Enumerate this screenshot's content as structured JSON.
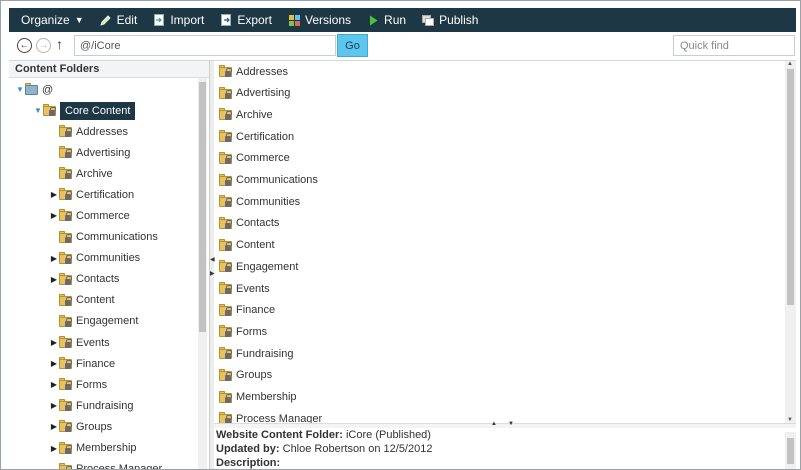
{
  "toolbar": {
    "organize": "Organize",
    "edit": "Edit",
    "import": "Import",
    "export": "Export",
    "versions": "Versions",
    "run": "Run",
    "publish": "Publish"
  },
  "address_bar": {
    "path_value": "@/iCore",
    "go_label": "Go",
    "quick_find_placeholder": "Quick find"
  },
  "content_folders": {
    "header": "Content Folders",
    "root_label": "@",
    "selected_label": "Core Content",
    "items": [
      {
        "label": "Addresses",
        "expandable": false
      },
      {
        "label": "Advertising",
        "expandable": false
      },
      {
        "label": "Archive",
        "expandable": false
      },
      {
        "label": "Certification",
        "expandable": true
      },
      {
        "label": "Commerce",
        "expandable": true
      },
      {
        "label": "Communications",
        "expandable": false
      },
      {
        "label": "Communities",
        "expandable": true
      },
      {
        "label": "Contacts",
        "expandable": true
      },
      {
        "label": "Content",
        "expandable": false
      },
      {
        "label": "Engagement",
        "expandable": false
      },
      {
        "label": "Events",
        "expandable": true
      },
      {
        "label": "Finance",
        "expandable": true
      },
      {
        "label": "Forms",
        "expandable": true
      },
      {
        "label": "Fundraising",
        "expandable": true
      },
      {
        "label": "Groups",
        "expandable": true
      },
      {
        "label": "Membership",
        "expandable": true
      },
      {
        "label": "Process Manager",
        "expandable": false
      }
    ]
  },
  "folder_list": [
    "Addresses",
    "Advertising",
    "Archive",
    "Certification",
    "Commerce",
    "Communications",
    "Communities",
    "Contacts",
    "Content",
    "Engagement",
    "Events",
    "Finance",
    "Forms",
    "Fundraising",
    "Groups",
    "Membership",
    "Process Manager"
  ],
  "details": {
    "folder_label": "Website Content Folder:",
    "folder_value": "iCore (Published)",
    "updated_label": "Updated by:",
    "updated_value": "Chloe Robertson on 12/5/2012",
    "description_label": "Description:"
  },
  "colors": {
    "toolbar_bg": "#1d3745",
    "go_button": "#5cc6ef",
    "folder": "#e6c262"
  }
}
